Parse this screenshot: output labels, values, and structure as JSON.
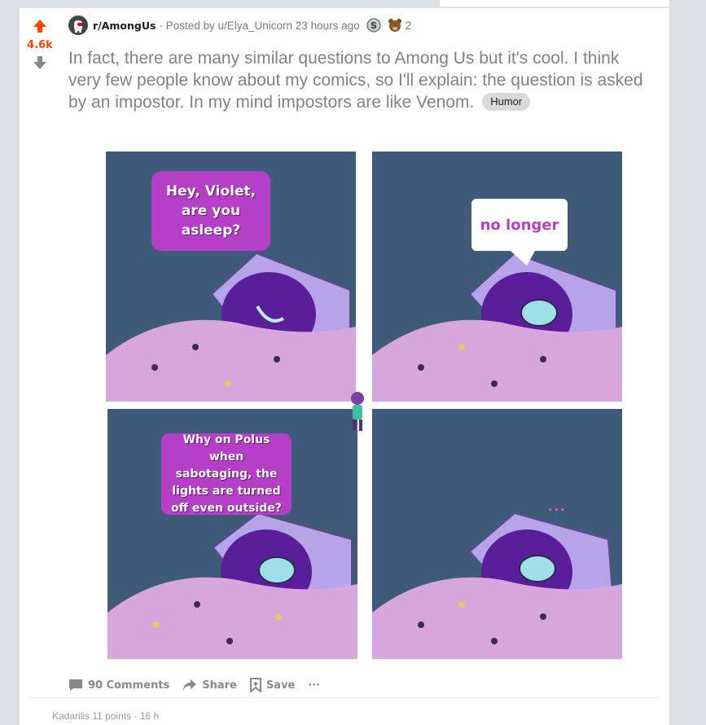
{
  "vote": {
    "score": "4.6k"
  },
  "post": {
    "subreddit": "r/AmongUs",
    "meta": "· Posted by u/Elya_Unicorn 23 hours ago",
    "award_count": "2",
    "title": "In fact, there are many similar questions to Among Us but it's cool. I think very few people know about my comics, so I'll explain: the question is asked by an impostor. In my mind impostors are like Venom.",
    "flair": "Humor"
  },
  "comic": {
    "panel1_text": "Hey, Violet, are you asleep?",
    "panel2_text": "no longer",
    "panel3_text": "Why on Polus when sabotaging, the lights are turned off even outside?",
    "panel4_text": "..."
  },
  "actions": {
    "comments": "90 Comments",
    "share": "Share",
    "save": "Save",
    "more": "···"
  },
  "under_text": "Kadarilis 11 points · 16 h"
}
